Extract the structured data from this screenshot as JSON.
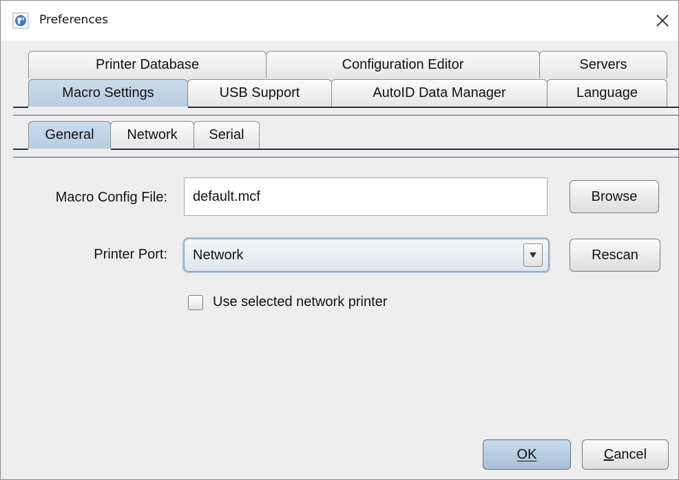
{
  "window": {
    "title": "Preferences",
    "icon": "globe-app-icon",
    "close_icon": "close-icon"
  },
  "tabs": {
    "row_top": [
      {
        "label": "Printer Database"
      },
      {
        "label": "Configuration Editor"
      },
      {
        "label": "Servers"
      }
    ],
    "row_bottom": [
      {
        "label": "Macro Settings",
        "selected": true
      },
      {
        "label": "USB Support"
      },
      {
        "label": "AutoID Data Manager"
      },
      {
        "label": "Language"
      }
    ]
  },
  "subtabs": [
    {
      "label": "General",
      "selected": true
    },
    {
      "label": "Network"
    },
    {
      "label": "Serial"
    }
  ],
  "form": {
    "config_file_label": "Macro Config File:",
    "config_file_value": "default.mcf",
    "browse_label": "Browse",
    "printer_port_label": "Printer Port:",
    "printer_port_value": "Network",
    "rescan_label": "Rescan",
    "use_network_printer_label": "Use selected network printer",
    "use_network_printer_checked": false
  },
  "footer": {
    "ok_label": "OK",
    "cancel_label": "Cancel"
  },
  "colors": {
    "selected_tab": "#c2d6ea",
    "default_button": "#b6cce2",
    "rule": "#1f2f44"
  }
}
